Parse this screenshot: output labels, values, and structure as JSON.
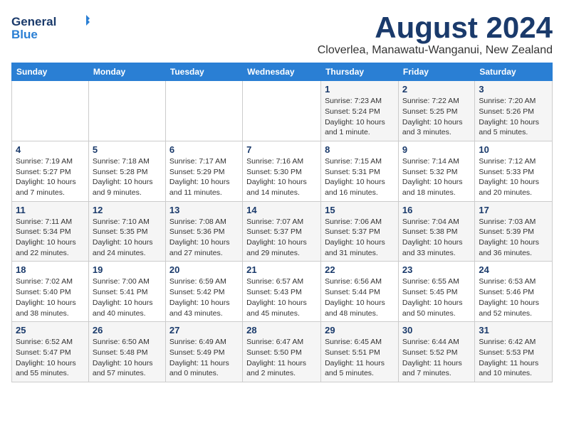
{
  "header": {
    "logo_general": "General",
    "logo_blue": "Blue",
    "title": "August 2024",
    "subtitle": "Cloverlea, Manawatu-Wanganui, New Zealand"
  },
  "weekdays": [
    "Sunday",
    "Monday",
    "Tuesday",
    "Wednesday",
    "Thursday",
    "Friday",
    "Saturday"
  ],
  "weeks": [
    [
      {
        "day": "",
        "info": ""
      },
      {
        "day": "",
        "info": ""
      },
      {
        "day": "",
        "info": ""
      },
      {
        "day": "",
        "info": ""
      },
      {
        "day": "1",
        "info": "Sunrise: 7:23 AM\nSunset: 5:24 PM\nDaylight: 10 hours\nand 1 minute."
      },
      {
        "day": "2",
        "info": "Sunrise: 7:22 AM\nSunset: 5:25 PM\nDaylight: 10 hours\nand 3 minutes."
      },
      {
        "day": "3",
        "info": "Sunrise: 7:20 AM\nSunset: 5:26 PM\nDaylight: 10 hours\nand 5 minutes."
      }
    ],
    [
      {
        "day": "4",
        "info": "Sunrise: 7:19 AM\nSunset: 5:27 PM\nDaylight: 10 hours\nand 7 minutes."
      },
      {
        "day": "5",
        "info": "Sunrise: 7:18 AM\nSunset: 5:28 PM\nDaylight: 10 hours\nand 9 minutes."
      },
      {
        "day": "6",
        "info": "Sunrise: 7:17 AM\nSunset: 5:29 PM\nDaylight: 10 hours\nand 11 minutes."
      },
      {
        "day": "7",
        "info": "Sunrise: 7:16 AM\nSunset: 5:30 PM\nDaylight: 10 hours\nand 14 minutes."
      },
      {
        "day": "8",
        "info": "Sunrise: 7:15 AM\nSunset: 5:31 PM\nDaylight: 10 hours\nand 16 minutes."
      },
      {
        "day": "9",
        "info": "Sunrise: 7:14 AM\nSunset: 5:32 PM\nDaylight: 10 hours\nand 18 minutes."
      },
      {
        "day": "10",
        "info": "Sunrise: 7:12 AM\nSunset: 5:33 PM\nDaylight: 10 hours\nand 20 minutes."
      }
    ],
    [
      {
        "day": "11",
        "info": "Sunrise: 7:11 AM\nSunset: 5:34 PM\nDaylight: 10 hours\nand 22 minutes."
      },
      {
        "day": "12",
        "info": "Sunrise: 7:10 AM\nSunset: 5:35 PM\nDaylight: 10 hours\nand 24 minutes."
      },
      {
        "day": "13",
        "info": "Sunrise: 7:08 AM\nSunset: 5:36 PM\nDaylight: 10 hours\nand 27 minutes."
      },
      {
        "day": "14",
        "info": "Sunrise: 7:07 AM\nSunset: 5:37 PM\nDaylight: 10 hours\nand 29 minutes."
      },
      {
        "day": "15",
        "info": "Sunrise: 7:06 AM\nSunset: 5:37 PM\nDaylight: 10 hours\nand 31 minutes."
      },
      {
        "day": "16",
        "info": "Sunrise: 7:04 AM\nSunset: 5:38 PM\nDaylight: 10 hours\nand 33 minutes."
      },
      {
        "day": "17",
        "info": "Sunrise: 7:03 AM\nSunset: 5:39 PM\nDaylight: 10 hours\nand 36 minutes."
      }
    ],
    [
      {
        "day": "18",
        "info": "Sunrise: 7:02 AM\nSunset: 5:40 PM\nDaylight: 10 hours\nand 38 minutes."
      },
      {
        "day": "19",
        "info": "Sunrise: 7:00 AM\nSunset: 5:41 PM\nDaylight: 10 hours\nand 40 minutes."
      },
      {
        "day": "20",
        "info": "Sunrise: 6:59 AM\nSunset: 5:42 PM\nDaylight: 10 hours\nand 43 minutes."
      },
      {
        "day": "21",
        "info": "Sunrise: 6:57 AM\nSunset: 5:43 PM\nDaylight: 10 hours\nand 45 minutes."
      },
      {
        "day": "22",
        "info": "Sunrise: 6:56 AM\nSunset: 5:44 PM\nDaylight: 10 hours\nand 48 minutes."
      },
      {
        "day": "23",
        "info": "Sunrise: 6:55 AM\nSunset: 5:45 PM\nDaylight: 10 hours\nand 50 minutes."
      },
      {
        "day": "24",
        "info": "Sunrise: 6:53 AM\nSunset: 5:46 PM\nDaylight: 10 hours\nand 52 minutes."
      }
    ],
    [
      {
        "day": "25",
        "info": "Sunrise: 6:52 AM\nSunset: 5:47 PM\nDaylight: 10 hours\nand 55 minutes."
      },
      {
        "day": "26",
        "info": "Sunrise: 6:50 AM\nSunset: 5:48 PM\nDaylight: 10 hours\nand 57 minutes."
      },
      {
        "day": "27",
        "info": "Sunrise: 6:49 AM\nSunset: 5:49 PM\nDaylight: 11 hours\nand 0 minutes."
      },
      {
        "day": "28",
        "info": "Sunrise: 6:47 AM\nSunset: 5:50 PM\nDaylight: 11 hours\nand 2 minutes."
      },
      {
        "day": "29",
        "info": "Sunrise: 6:45 AM\nSunset: 5:51 PM\nDaylight: 11 hours\nand 5 minutes."
      },
      {
        "day": "30",
        "info": "Sunrise: 6:44 AM\nSunset: 5:52 PM\nDaylight: 11 hours\nand 7 minutes."
      },
      {
        "day": "31",
        "info": "Sunrise: 6:42 AM\nSunset: 5:53 PM\nDaylight: 11 hours\nand 10 minutes."
      }
    ]
  ]
}
